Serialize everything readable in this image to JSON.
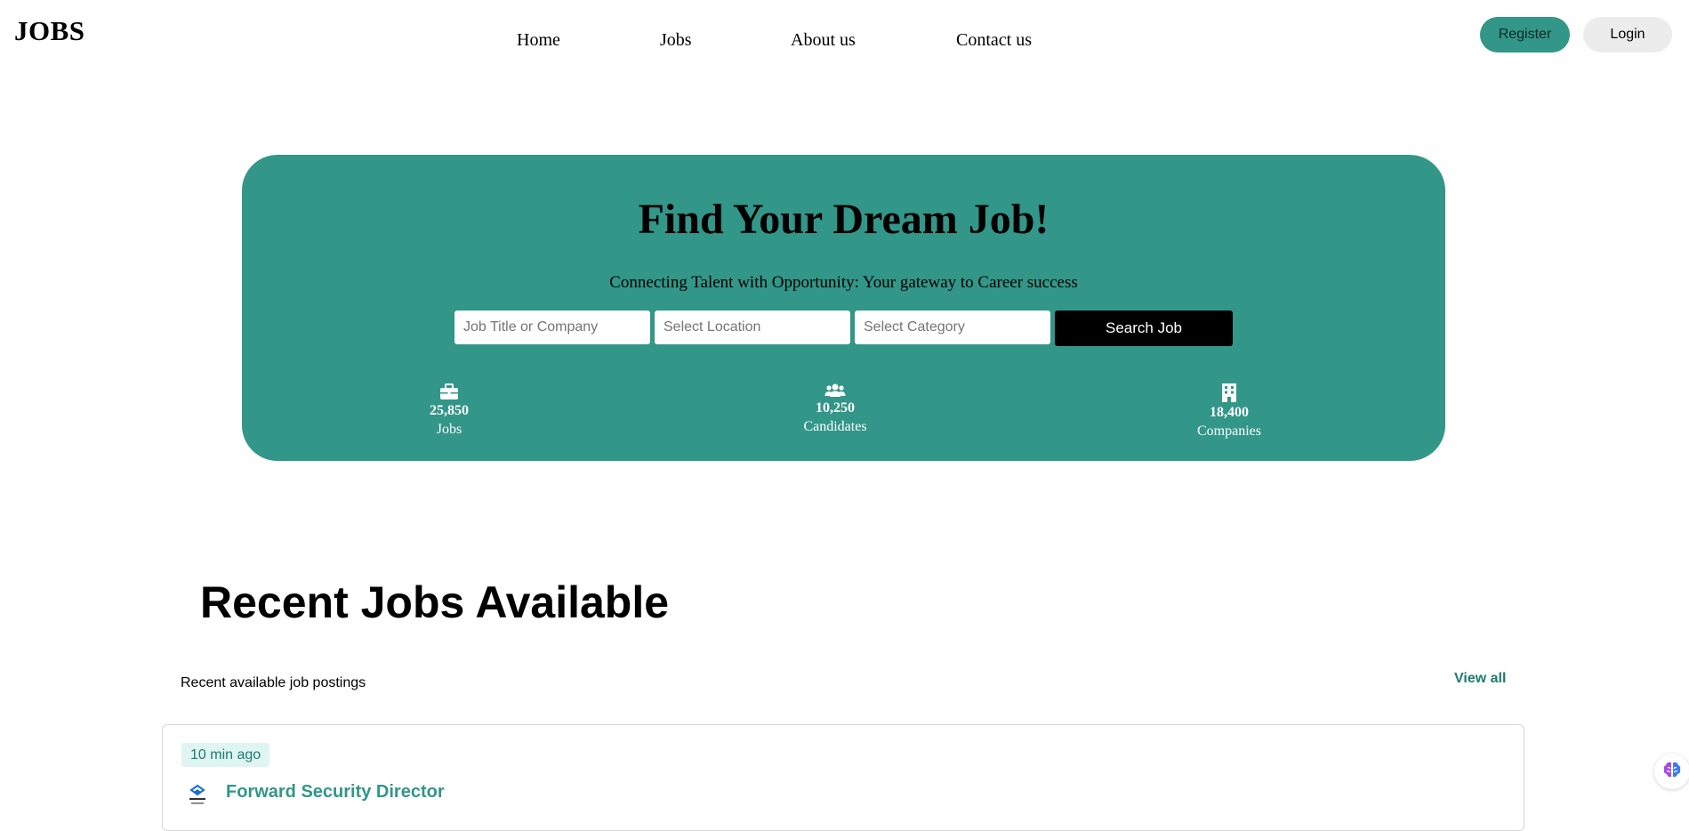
{
  "header": {
    "logo": "JOBS",
    "nav": [
      {
        "label": "Home"
      },
      {
        "label": "Jobs"
      },
      {
        "label": "About us"
      },
      {
        "label": "Contact us"
      }
    ],
    "register_label": "Register",
    "login_label": "Login"
  },
  "hero": {
    "title": "Find Your Dream Job!",
    "subtitle": "Connecting Talent with Opportunity: Your gateway to Career success",
    "search": {
      "job_placeholder": "Job Title or Company",
      "location_placeholder": "Select Location",
      "category_placeholder": "Select Category",
      "button_label": "Search Job"
    },
    "stats": [
      {
        "icon": "briefcase-icon",
        "value": "25,850",
        "label": "Jobs"
      },
      {
        "icon": "users-icon",
        "value": "10,250",
        "label": "Candidates"
      },
      {
        "icon": "building-icon",
        "value": "18,400",
        "label": "Companies"
      }
    ]
  },
  "recent": {
    "title": "Recent Jobs Available",
    "subtitle": "Recent available job postings",
    "view_all_label": "View all",
    "jobs": [
      {
        "time": "10 min ago",
        "title": "Forward Security Director",
        "logo_icon": "company-logo-icon"
      }
    ]
  },
  "assistant_button": {
    "icon": "brain-icon"
  },
  "colors": {
    "accent": "#329688",
    "accent_dark": "#1f7a70",
    "badge_bg": "#dff5f2",
    "login_bg": "#ececec"
  }
}
